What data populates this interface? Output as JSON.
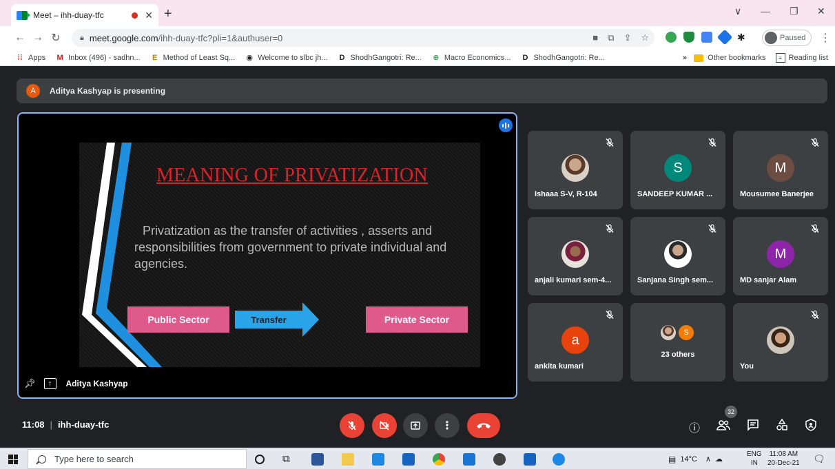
{
  "browser": {
    "tab_title": "Meet – ihh-duay-tfc",
    "new_tab": "+",
    "url_host": "meet.google.com",
    "url_path": "/ihh-duay-tfc?pli=1&authuser=0",
    "profile_status": "Paused",
    "window_controls": {
      "chevron": "∨",
      "minimize": "—",
      "restore": "❐",
      "close": "✕"
    }
  },
  "bookmarks": {
    "items": [
      {
        "label": "Apps",
        "icon": "apps-grid-icon",
        "color": "#ea4335"
      },
      {
        "label": "Inbox (496) - sadhn...",
        "icon": "gmail-icon",
        "color": "#c5221f"
      },
      {
        "label": "Method of Least Sq...",
        "icon": "E-logo-icon",
        "color": "#e37400"
      },
      {
        "label": "Welcome to slbc jh...",
        "icon": "globe-icon",
        "color": "#202124"
      },
      {
        "label": "ShodhGangotri: Re...",
        "icon": "D-logo-icon",
        "color": "#202124"
      },
      {
        "label": "Macro Economics...",
        "icon": "g-circle-icon",
        "color": "#34a853"
      },
      {
        "label": "ShodhGangotri: Re...",
        "icon": "D-logo-icon",
        "color": "#202124"
      }
    ],
    "more": "»",
    "other": "Other bookmarks",
    "reading": "Reading list"
  },
  "meet": {
    "presenter_banner": "Aditya Kashyap is presenting",
    "presenter_initial": "A",
    "stage_name": "Aditya Kashyap",
    "slide": {
      "title": "MEANING OF PRIVATIZATION",
      "body": "Privatization as the transfer of activities , asserts and responsibilities from government to private individual and agencies.",
      "box_left": "Public Sector",
      "arrow_label": "Transfer",
      "box_right": "Private Sector"
    },
    "tiles": [
      {
        "name": "Ishaaa S-V, R-104",
        "avatar": "photo",
        "initial": "",
        "color": ""
      },
      {
        "name": "SANDEEP KUMAR ...",
        "avatar": "letter",
        "initial": "S",
        "color": "#00897b"
      },
      {
        "name": "Mousumee Banerjee",
        "avatar": "letter",
        "initial": "M",
        "color": "#6d4c41"
      },
      {
        "name": "anjali kumari sem-4...",
        "avatar": "photo",
        "initial": "",
        "color": ""
      },
      {
        "name": "Sanjana Singh sem...",
        "avatar": "photo",
        "initial": "",
        "color": ""
      },
      {
        "name": "MD sanjar Alam",
        "avatar": "letter",
        "initial": "M",
        "color": "#8e24aa"
      },
      {
        "name": "ankita kumari",
        "avatar": "letter",
        "initial": "a",
        "color": "#e8430c"
      },
      {
        "name": "23 others",
        "avatar": "group",
        "initial": "S",
        "color": "#f57c00"
      },
      {
        "name": "You",
        "avatar": "photo",
        "initial": "",
        "color": ""
      }
    ],
    "time": "11:08",
    "meeting_code": "ihh-duay-tfc",
    "people_count": "32"
  },
  "taskbar": {
    "search_placeholder": "Type here to search",
    "weather": "14°C",
    "lang_top": "ENG",
    "lang_bottom": "IN",
    "time": "11:08 AM",
    "date": "20-Dec-21"
  },
  "colors": {
    "meet_bg": "#202124",
    "tile_bg": "#3c4043",
    "accent_blue": "#8ab4f8",
    "end_call_red": "#ea4335",
    "slide_title_red": "#d8232a",
    "slide_box_pink": "#dd5a8a",
    "slide_arrow_blue": "#2aa4e8"
  }
}
